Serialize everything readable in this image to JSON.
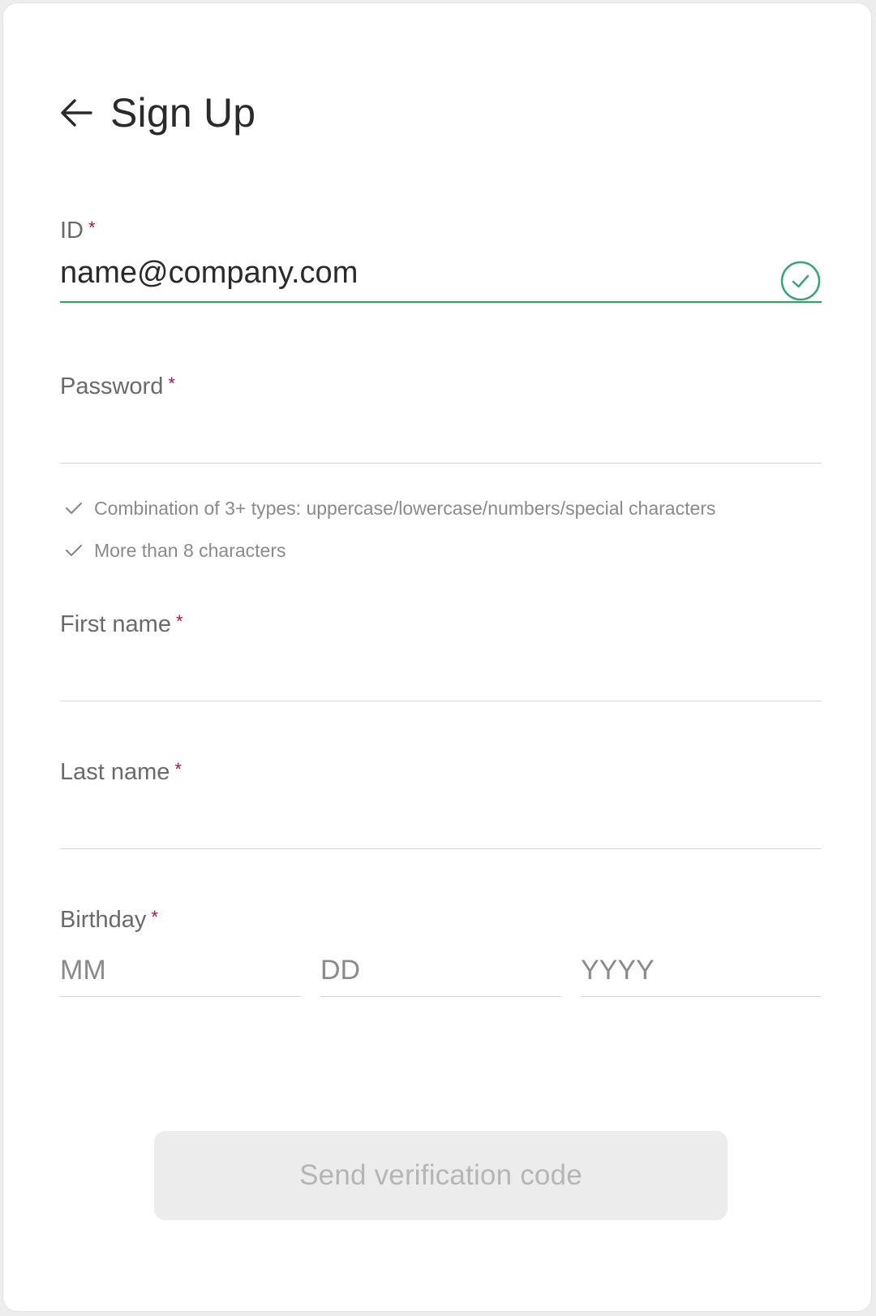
{
  "header": {
    "title": "Sign Up"
  },
  "form": {
    "id": {
      "label": "ID",
      "required_mark": "*",
      "value": "name@company.com"
    },
    "password": {
      "label": "Password",
      "required_mark": "*",
      "value": ""
    },
    "password_rules": [
      "Combination of 3+ types: uppercase/lowercase/numbers/special characters",
      "More than 8 characters"
    ],
    "first_name": {
      "label": "First name",
      "required_mark": "*",
      "value": ""
    },
    "last_name": {
      "label": "Last name",
      "required_mark": "*",
      "value": ""
    },
    "birthday": {
      "label": "Birthday",
      "required_mark": "*",
      "month_placeholder": "MM",
      "day_placeholder": "DD",
      "year_placeholder": "YYYY"
    }
  },
  "submit": {
    "label": "Send verification code",
    "enabled": false
  },
  "colors": {
    "required": "#a3174a",
    "valid": "#2fa35a",
    "valid_icon": "#3aa37a"
  },
  "icons": {
    "back": "arrow-left-icon",
    "valid": "check-circle-icon",
    "rule": "check-icon"
  }
}
